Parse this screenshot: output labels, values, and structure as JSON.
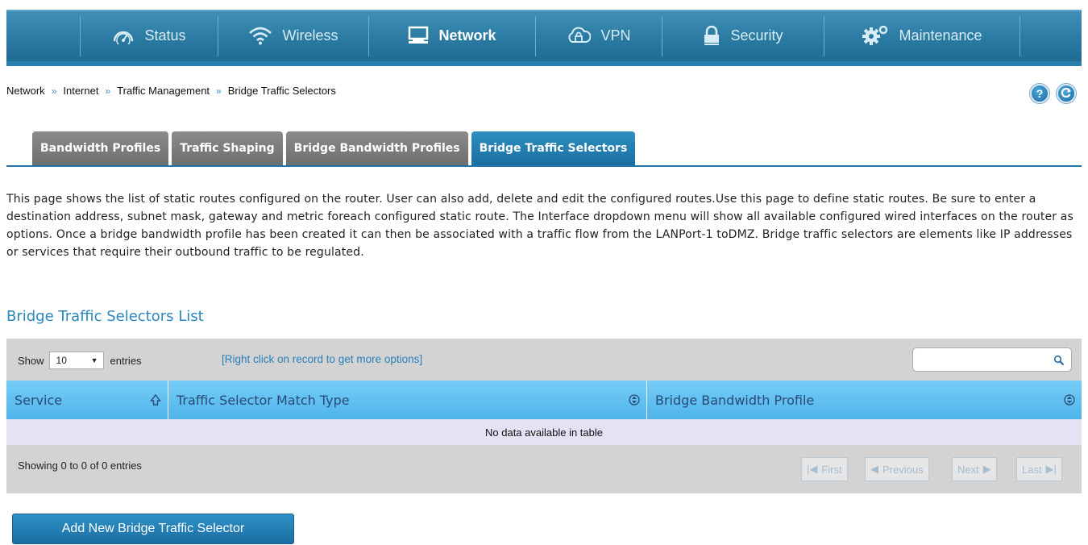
{
  "nav": {
    "items": [
      {
        "label": "Status",
        "icon": "gauge-icon",
        "active": false
      },
      {
        "label": "Wireless",
        "icon": "wifi-icon",
        "active": false
      },
      {
        "label": "Network",
        "icon": "monitor-icon",
        "active": true
      },
      {
        "label": "VPN",
        "icon": "cloud-lock-icon",
        "active": false
      },
      {
        "label": "Security",
        "icon": "padlock-icon",
        "active": false
      },
      {
        "label": "Maintenance",
        "icon": "gears-icon",
        "active": false
      }
    ]
  },
  "breadcrumb": {
    "items": [
      "Network",
      "Internet",
      "Traffic Management",
      "Bridge Traffic Selectors"
    ],
    "separator": "»"
  },
  "help": {
    "help_glyph": "?"
  },
  "tabs": [
    {
      "label": "Bandwidth Profiles",
      "active": false
    },
    {
      "label": "Traffic Shaping",
      "active": false
    },
    {
      "label": "Bridge Bandwidth Profiles",
      "active": false
    },
    {
      "label": "Bridge Traffic Selectors",
      "active": true
    }
  ],
  "description": "This page shows the list of static routes configured on the router. User can also add, delete and edit the configured routes.Use this page to define static routes. Be sure to enter a destination address, subnet mask, gateway and metric foreach configured static route. The Interface dropdown menu will show all available configured wired interfaces on the router as options. Once a bridge bandwidth profile has been created it can then be associated with a traffic flow from the LANPort-1 toDMZ. Bridge traffic selectors are elements like IP addresses or services that require their outbound traffic to be regulated.",
  "section_title": "Bridge Traffic Selectors List",
  "table": {
    "show_label": "Show",
    "entries_value": "10",
    "entries_label": "entries",
    "hint": "[Right click on record to get more options]",
    "search_value": "",
    "columns": [
      "Service",
      "Traffic Selector Match Type",
      "Bridge Bandwidth Profile"
    ],
    "empty_message": "No data available in table",
    "info": "Showing 0 to 0 of 0 entries",
    "pager": {
      "first": "First",
      "previous": "Previous",
      "next": "Next",
      "last": "Last"
    }
  },
  "add_button": "Add New Bridge Traffic Selector",
  "colors": {
    "nav_bar": "#2a7aa2",
    "active_tab": "#1b6fa0",
    "inactive_tab": "#7c7c7c",
    "header_row": "#5fbff0",
    "section_title": "#2a86be",
    "hint": "#2a7fb8"
  }
}
